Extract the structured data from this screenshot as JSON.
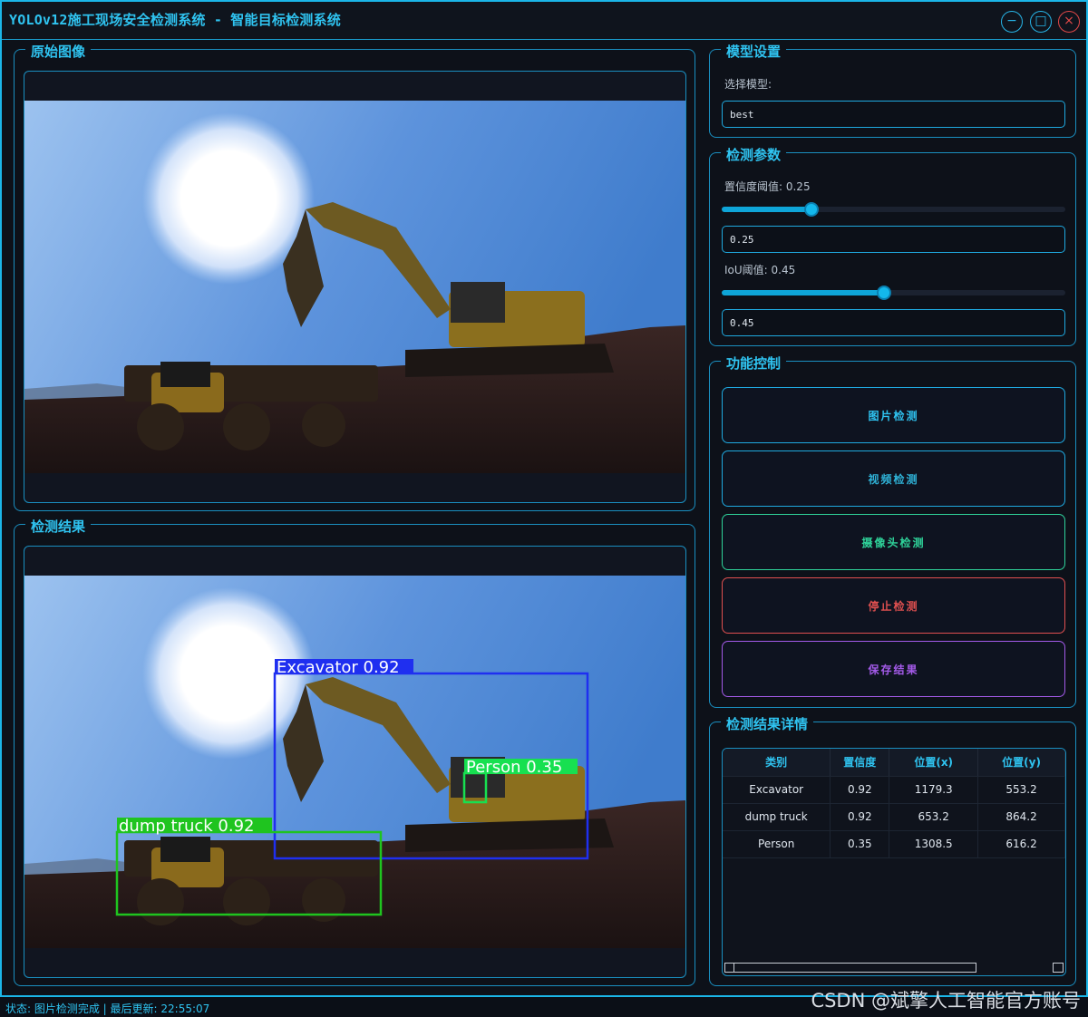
{
  "window": {
    "title": "YOLOv12施工现场安全检测系统 - 智能目标检测系统",
    "minimize_glyph": "−",
    "maximize_glyph": "□",
    "close_glyph": "×"
  },
  "panels": {
    "original_title": "原始图像",
    "result_title": "检测结果"
  },
  "detections_overlay": [
    {
      "label": "Excavator 0.92",
      "color": "#1f2ff0"
    },
    {
      "label": "Person 0.35",
      "color": "#17e050"
    },
    {
      "label": "dump truck 0.92",
      "color": "#1fc41f"
    }
  ],
  "model": {
    "title": "模型设置",
    "select_label": "选择模型:",
    "selected": "best"
  },
  "params": {
    "title": "检测参数",
    "conf_label": "置信度阈值: 0.25",
    "conf_value": "0.25",
    "conf_level": 0.25,
    "iou_label": "IoU阈值: 0.45",
    "iou_value": "0.45",
    "iou_level": 0.45
  },
  "controls": {
    "title": "功能控制",
    "image_btn": "图片检测",
    "video_btn": "视频检测",
    "camera_btn": "摄像头检测",
    "stop_btn": "停止检测",
    "save_btn": "保存结果"
  },
  "details": {
    "title": "检测结果详情",
    "columns": [
      "类别",
      "置信度",
      "位置(x)",
      "位置(y)"
    ],
    "rows": [
      [
        "Excavator",
        "0.92",
        "1179.3",
        "553.2"
      ],
      [
        "dump truck",
        "0.92",
        "653.2",
        "864.2"
      ],
      [
        "Person",
        "0.35",
        "1308.5",
        "616.2"
      ]
    ]
  },
  "status": "状态: 图片检测完成 | 最后更新: 22:55:07",
  "watermark": "CSDN @斌擎人工智能官方账号",
  "colors": {
    "accent": "#2fc3f0",
    "camera_btn": "#2fd39a",
    "stop_btn": "#e05050",
    "save_btn": "#a35ae8"
  }
}
